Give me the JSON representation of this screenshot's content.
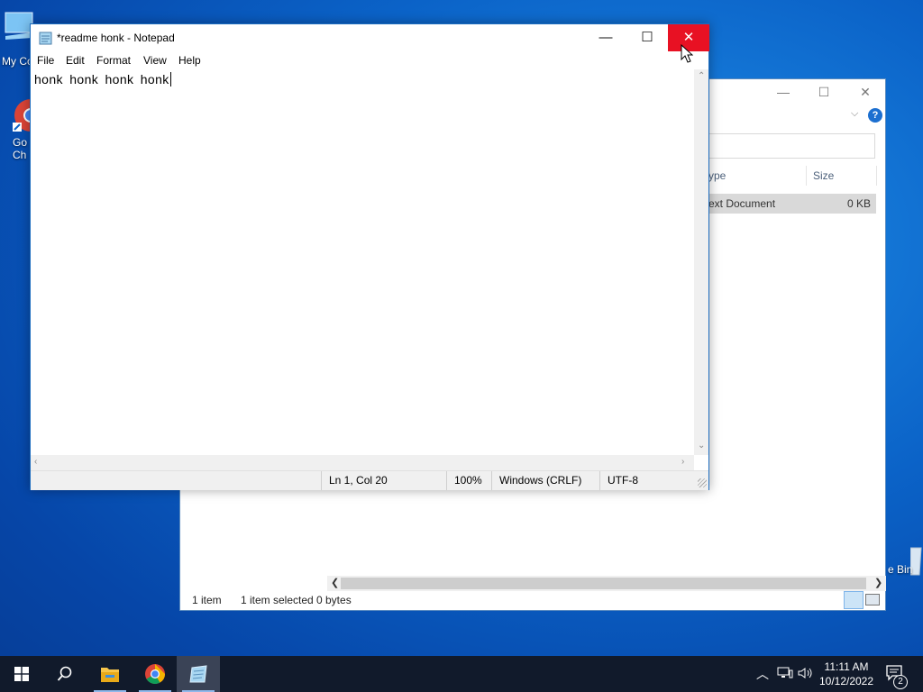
{
  "desktop": {
    "icons": [
      {
        "label": "My Co"
      },
      {
        "label_line1": "Go",
        "label_line2": "Ch"
      },
      {
        "label": "e Bin"
      }
    ]
  },
  "explorer": {
    "columns": {
      "type": "ype",
      "size": "Size"
    },
    "selected_row": {
      "type": "ext Document",
      "size": "0 KB"
    },
    "status": {
      "items": "1 item",
      "selected": "1 item selected",
      "bytes": "0 bytes"
    }
  },
  "notepad": {
    "title": "*readme honk - Notepad",
    "menu": [
      "File",
      "Edit",
      "Format",
      "View",
      "Help"
    ],
    "content": "honk  honk  honk  honk",
    "status": {
      "position": "Ln 1, Col 20",
      "zoom": "100%",
      "line_ending": "Windows (CRLF)",
      "encoding": "UTF-8"
    },
    "controls": {
      "minimize": "—",
      "maximize": "☐",
      "close": "✕"
    }
  },
  "taskbar": {
    "apps": [
      "start-icon",
      "search-icon",
      "file-explorer-icon",
      "chrome-icon",
      "notepad-icon"
    ],
    "clock": {
      "time": "11:11 AM",
      "date": "10/12/2022"
    },
    "notifications": "2"
  },
  "colors": {
    "close_red": "#e81123",
    "taskbar": "#111a2b",
    "desktop_blue": "#0b63c8"
  }
}
